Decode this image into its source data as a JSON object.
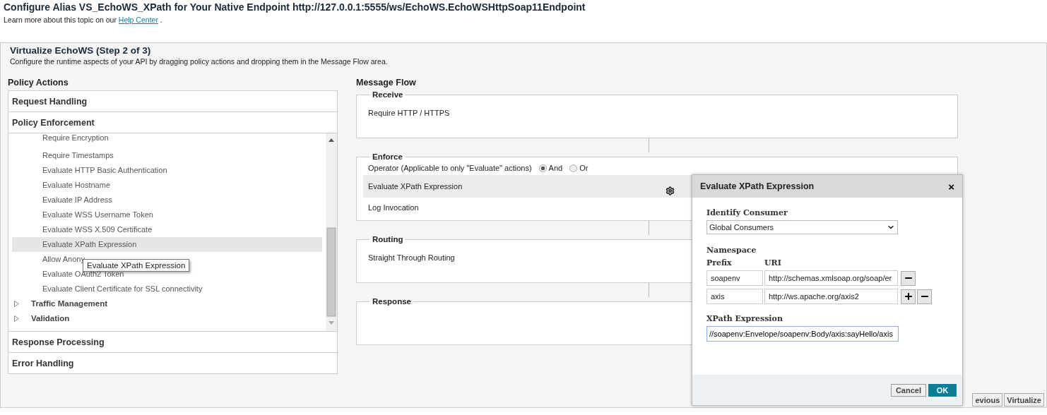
{
  "page": {
    "title": "Configure Alias VS_EchoWS_XPath for Your Native Endpoint http://127.0.0.1:5555/ws/EchoWS.EchoWSHttpSoap11Endpoint",
    "help_prefix": "Learn more about this topic on our",
    "help_link": "Help Center",
    "help_suffix": "."
  },
  "step": {
    "title": "Virtualize EchoWS (Step 2 of 3)",
    "description": "Configure the runtime aspects of your API by dragging policy actions and dropping them in the Message Flow area."
  },
  "policy_actions": {
    "title": "Policy Actions",
    "sections_top": [
      {
        "title": "Request Handling"
      },
      {
        "title": "Policy Enforcement"
      }
    ],
    "tree": [
      {
        "kind": "leaf",
        "label": "Require Encryption",
        "selected": false
      },
      {
        "kind": "leaf",
        "label": "Require Timestamps",
        "selected": false
      },
      {
        "kind": "leaf",
        "label": "Evaluate HTTP Basic Authentication",
        "selected": false
      },
      {
        "kind": "leaf",
        "label": "Evaluate Hostname",
        "selected": false
      },
      {
        "kind": "leaf",
        "label": "Evaluate IP Address",
        "selected": false
      },
      {
        "kind": "leaf",
        "label": "Evaluate WSS Username Token",
        "selected": false
      },
      {
        "kind": "leaf",
        "label": "Evaluate WSS X.509 Certificate",
        "selected": false
      },
      {
        "kind": "leaf",
        "label": "Evaluate XPath Expression",
        "selected": true
      },
      {
        "kind": "leaf",
        "label": "Allow Anony",
        "selected": false,
        "tooltip": "Evaluate XPath Expression"
      },
      {
        "kind": "leaf",
        "label": "Evaluate OAuth2 Token",
        "selected": false
      },
      {
        "kind": "leaf",
        "label": "Evaluate Client Certificate for SSL connectivity",
        "selected": false
      },
      {
        "kind": "group",
        "label": "Traffic Management",
        "expanded": false
      },
      {
        "kind": "group",
        "label": "Validation",
        "expanded": false
      }
    ],
    "sections_bottom": [
      {
        "title": "Response Processing"
      },
      {
        "title": "Error Handling"
      }
    ]
  },
  "message_flow": {
    "title": "Message Flow",
    "stages": [
      {
        "title": "Receive",
        "items": [
          {
            "label": "Require HTTP / HTTPS"
          }
        ]
      },
      {
        "title": "Enforce",
        "operator": {
          "label": "Operator (Applicable to only \"Evaluate\" actions)",
          "options": [
            {
              "label": "And",
              "selected": true
            },
            {
              "label": "Or",
              "selected": false
            }
          ]
        },
        "items": [
          {
            "label": "Evaluate XPath Expression",
            "selected": true
          },
          {
            "label": "Log Invocation",
            "selected": false
          }
        ]
      },
      {
        "title": "Routing",
        "items": [
          {
            "label": "Straight Through Routing"
          }
        ]
      },
      {
        "title": "Response"
      }
    ]
  },
  "dialog": {
    "title": "Evaluate XPath Expression",
    "close": "×",
    "consumer_label": "Identify Consumer",
    "consumer_value": "Global Consumers",
    "namespace_label": "Namespace",
    "prefix_header": "Prefix",
    "uri_header": "URI",
    "namespaces": [
      {
        "prefix": "soapenv",
        "uri": "http://schemas.xmlsoap.org/soap/er",
        "can_add": false
      },
      {
        "prefix": "axis",
        "uri": "http://ws.apache.org/axis2",
        "can_add": true
      }
    ],
    "xpath_label": "XPath Expression",
    "xpath_value": "//soapenv:Envelope/soapenv:Body/axis:sayHello/axis",
    "buttons": [
      {
        "label": "Cancel",
        "kind": "secondary"
      },
      {
        "label": "OK",
        "kind": "primary"
      }
    ]
  },
  "footer_buttons": [
    "evious",
    "Virtualize"
  ]
}
